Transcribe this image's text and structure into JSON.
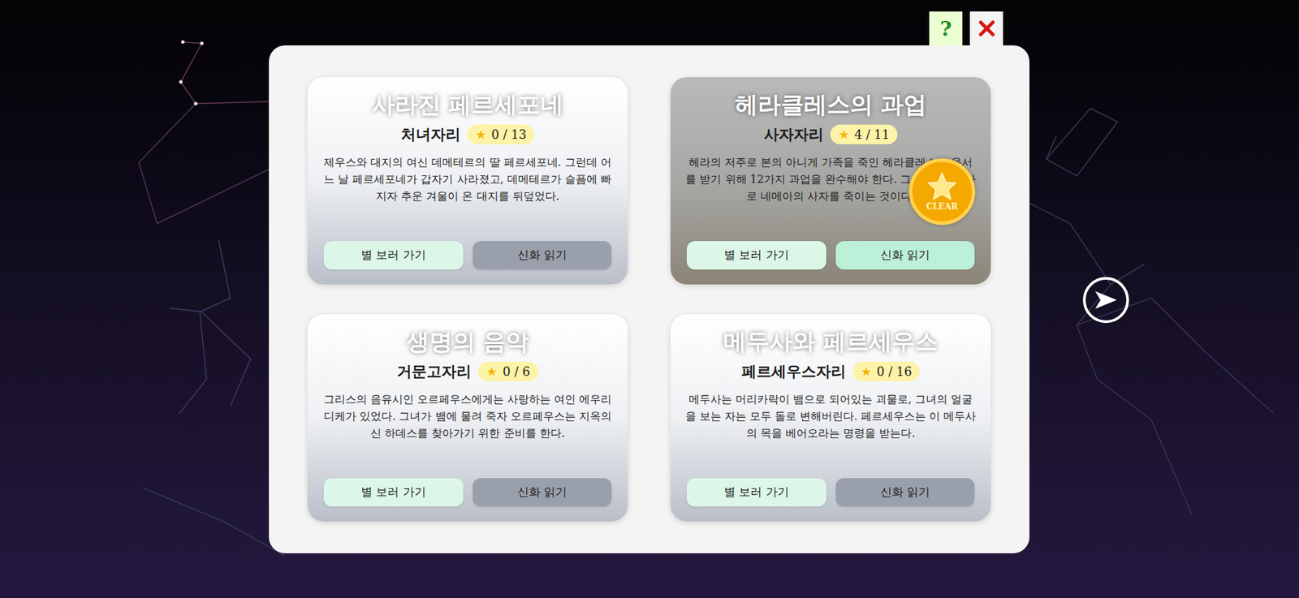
{
  "header": {
    "help": "?"
  },
  "cards": [
    {
      "title": "사라진 페르세포네",
      "constellation": "처녀자리",
      "star": "★",
      "stars": "0 / 13",
      "description": "제우스와 대지의 여신 데메테르의 딸 페르세포네. 그런데 어느 날 페르세포네가 갑자기 사라졌고, 데메테르가 슬픔에 빠지자 추운 겨울이 온 대지를 뒤덮었다.",
      "buttons": [
        "별 보러 가기",
        "신화 읽기"
      ],
      "cleared": false
    },
    {
      "title": "헤라클레스의 과업",
      "constellation": "사자자리",
      "star": "★",
      "stars": "4 / 11",
      "description": "헤라의 저주로 본의 아니게 가족을 죽인 헤라클레스는 용서를 받기 위해 12가지 과업을 완수해야 한다. 그 첫 번째가 바로 네메아의 사자를 죽이는 것이다.",
      "buttons": [
        "별 보러 가기",
        "신화 읽기"
      ],
      "cleared": true,
      "badge": "CLEAR"
    },
    {
      "title": "생명의 음악",
      "constellation": "거문고자리",
      "star": "★",
      "stars": "0 / 6",
      "description": "그리스의 음유시인 오르페우스에게는 사랑하는 여인 에우리디케가 있었다. 그녀가 뱀에 물려 죽자 오르페우스는 지옥의 신 하데스를 찾아가기 위한 준비를 한다.",
      "buttons": [
        "별 보러 가기",
        "신화 읽기"
      ],
      "cleared": false
    },
    {
      "title": "메두사와 페르세우스",
      "constellation": "페르세우스자리",
      "star": "★",
      "stars": "0 / 16",
      "description": "메두사는 머리카락이 뱀으로 되어있는 괴물로, 그녀의 얼굴을 보는 자는 모두 돌로 변해버린다. 페르세우스는 이 메두사의 목을 베어오라는 명령을 받는다.",
      "buttons": [
        "별 보러 가기",
        "신화 읽기"
      ],
      "cleared": false
    }
  ]
}
